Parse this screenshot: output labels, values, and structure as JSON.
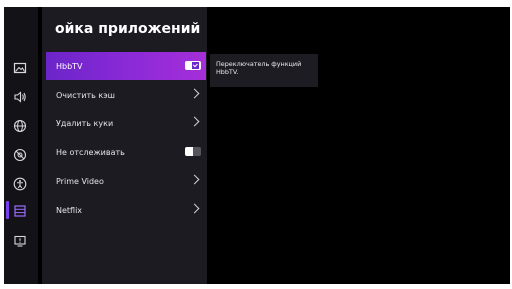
{
  "panel": {
    "title": "ойка приложений"
  },
  "rail": {
    "items": [
      {
        "icon": "picture-icon"
      },
      {
        "icon": "sound-icon"
      },
      {
        "icon": "globe-icon"
      },
      {
        "icon": "privacy-icon"
      },
      {
        "icon": "accessibility-icon"
      },
      {
        "icon": "app-settings-icon",
        "active": true
      },
      {
        "icon": "device-info-icon"
      }
    ],
    "accent_color": "#7b3ff2"
  },
  "menu": {
    "items": [
      {
        "label": "HbbTV",
        "control": "toggle",
        "state": "on",
        "selected": true
      },
      {
        "label": "Очистить кэш",
        "control": "chevron"
      },
      {
        "label": "Удалить куки",
        "control": "chevron"
      },
      {
        "label": "Не отслеживать",
        "control": "toggle",
        "state": "off"
      },
      {
        "label": "Prime Video",
        "control": "chevron"
      },
      {
        "label": "Netflix",
        "control": "chevron"
      }
    ]
  },
  "tooltip": {
    "text": "Переключатель функций HbbTV."
  },
  "colors": {
    "selected_gradient_start": "#6b25c9",
    "selected_gradient_end": "#a52fd8",
    "panel_bg": "#1b1b21",
    "background": "#000000"
  }
}
